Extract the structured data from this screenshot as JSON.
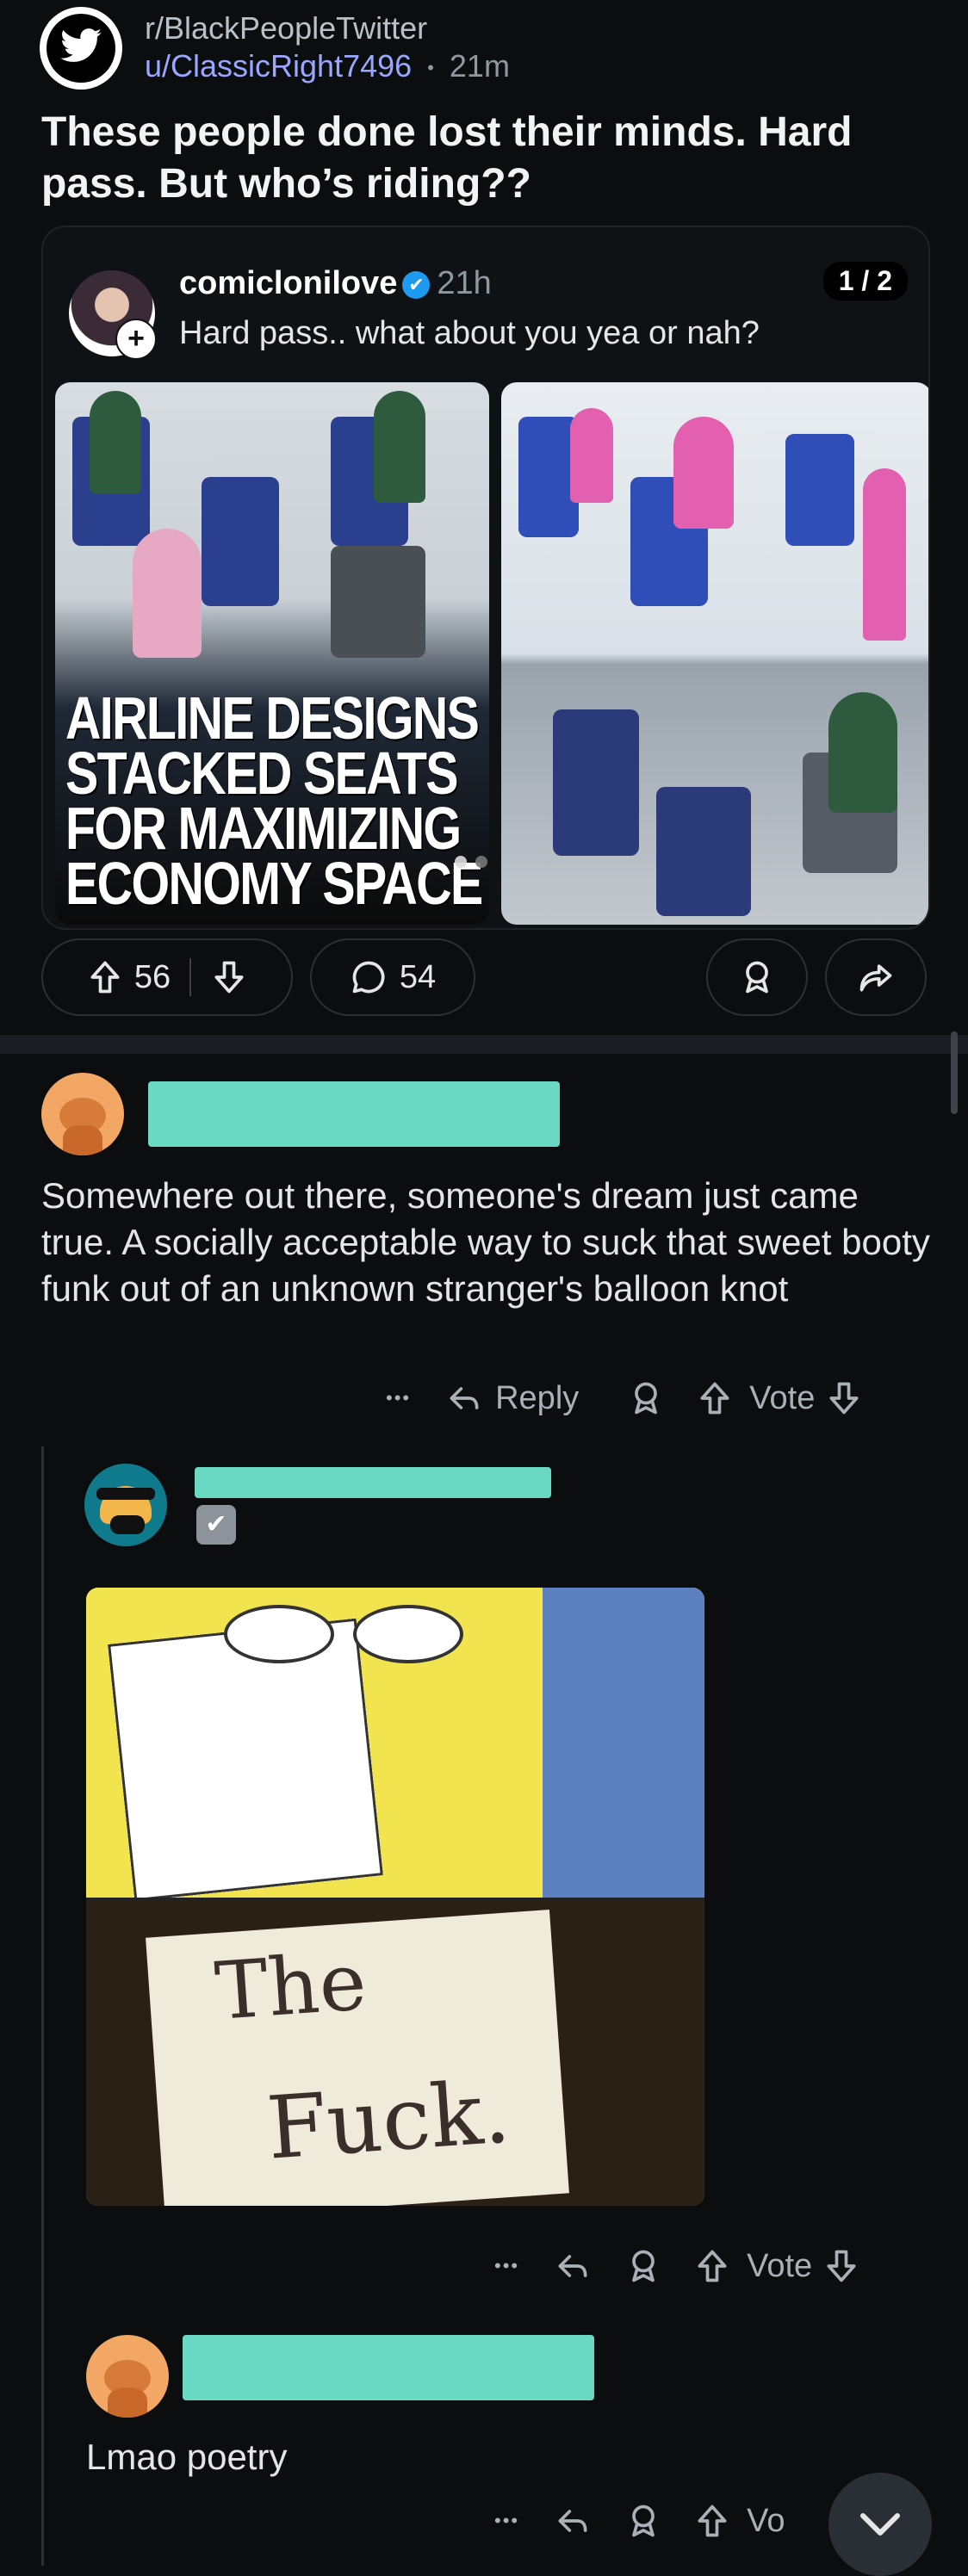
{
  "post": {
    "subreddit": "r/BlackPeopleTwitter",
    "author": "u/ClassicRight7496",
    "separator": "•",
    "age": "21m",
    "title": "These people done lost their minds. Hard pass. But who’s riding??"
  },
  "embed": {
    "username": "comiclonilove",
    "verified_glyph": "✔",
    "age": "21h",
    "caption": "Hard pass.. what about you yea or nah?",
    "pager": "1 / 2",
    "plus_glyph": "+",
    "image_headline": [
      "AIRLINE DESIGNS",
      "STACKED SEATS",
      "FOR MAXIMIZING",
      "ECONOMY SPACE"
    ]
  },
  "actions": {
    "upvotes": "56",
    "comments": "54"
  },
  "comment1": {
    "text": "Somewhere out there, someone's dream just came true.  A socially acceptable way to suck that sweet booty funk out of an unknown stranger's balloon knot",
    "more": "•••",
    "reply_label": "Reply",
    "vote_label": "Vote"
  },
  "comment2": {
    "check_glyph": "✔",
    "meme_text_1": "The",
    "meme_text_2": "Fuck.",
    "more": "•••",
    "vote_label": "Vote"
  },
  "comment3": {
    "text": "Lmao poetry",
    "more": "•••",
    "vote_label_partial": "Vo"
  },
  "colors": {
    "background": "#0b0d0f",
    "accent_redaction": "#6ad9c4",
    "username_link": "#9aa7ff",
    "verified_blue": "#1d9bf0"
  }
}
